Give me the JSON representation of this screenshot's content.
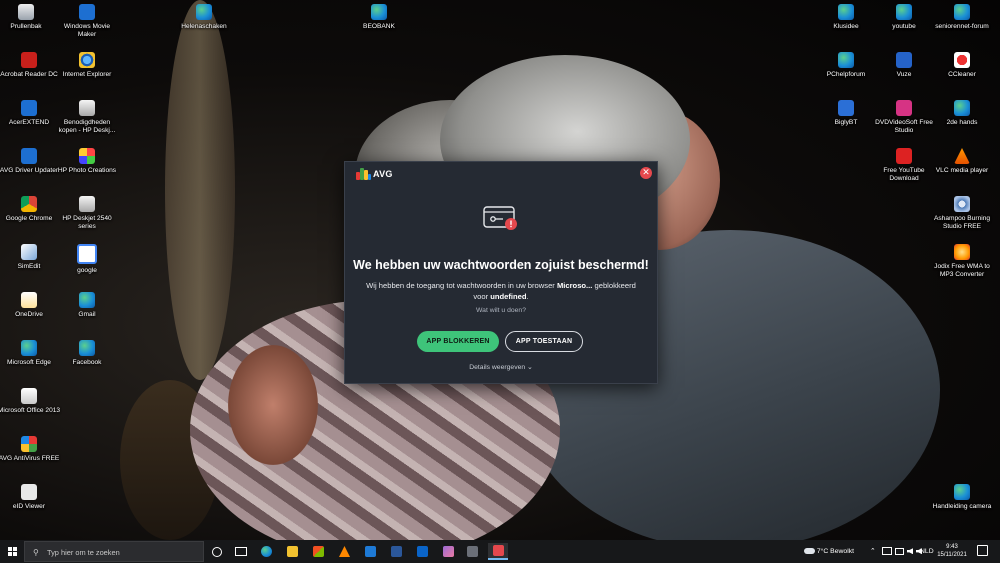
{
  "desktop": {
    "icons_left": [
      {
        "label": "Prullenbak",
        "icon": "recycle-bin-icon"
      },
      {
        "label": "Windows Movie Maker",
        "icon": "movie-maker-icon"
      },
      {
        "label": "Acrobat Reader DC",
        "icon": "acrobat-icon"
      },
      {
        "label": "Internet Explorer",
        "icon": "internet-explorer-icon"
      },
      {
        "label": "AcerEXTEND",
        "icon": "acer-extend-icon"
      },
      {
        "label": "Benodigdheden kopen - HP Deskj...",
        "icon": "hp-supplies-icon"
      },
      {
        "label": "AVG Driver Updater",
        "icon": "avg-driver-icon"
      },
      {
        "label": "HP Photo Creations",
        "icon": "hp-photo-icon"
      },
      {
        "label": "Google Chrome",
        "icon": "chrome-icon"
      },
      {
        "label": "HP Deskjet 2540 series",
        "icon": "printer-icon"
      },
      {
        "label": "SimEdit",
        "icon": "simedit-icon"
      },
      {
        "label": "google",
        "icon": "google-icon"
      },
      {
        "label": "OneDrive",
        "icon": "onedrive-icon"
      },
      {
        "label": "Gmail",
        "icon": "gmail-edge-icon"
      },
      {
        "label": "Microsoft Edge",
        "icon": "edge-icon"
      },
      {
        "label": "Facebook",
        "icon": "facebook-edge-icon"
      },
      {
        "label": "Microsoft Office 2013",
        "icon": "office-icon"
      },
      {
        "label": "AVG AntiVirus FREE",
        "icon": "avg-antivirus-icon"
      },
      {
        "label": "eID Viewer",
        "icon": "eid-viewer-icon"
      }
    ],
    "icons_top": [
      {
        "label": "Helenaschaken",
        "icon": "edge-shortcut-icon"
      },
      {
        "label": "BEOBANK",
        "icon": "edge-shortcut-icon"
      }
    ],
    "icons_right": [
      {
        "label": "Klusidee",
        "icon": "edge-shortcut-icon"
      },
      {
        "label": "youtube",
        "icon": "edge-shortcut-icon"
      },
      {
        "label": "seniorennet-forum",
        "icon": "edge-shortcut-icon"
      },
      {
        "label": "PChelpforum",
        "icon": "edge-shortcut-icon"
      },
      {
        "label": "Vuze",
        "icon": "vuze-icon"
      },
      {
        "label": "CCleaner",
        "icon": "ccleaner-icon"
      },
      {
        "label": "BiglyBT",
        "icon": "biglybt-icon"
      },
      {
        "label": "DVDVideoSoft Free Studio",
        "icon": "dvdvideosoft-icon"
      },
      {
        "label": "2de hands",
        "icon": "edge-shortcut-icon"
      },
      {
        "label": "Free YouTube Download",
        "icon": "youtube-download-icon"
      },
      {
        "label": "VLC media player",
        "icon": "vlc-icon"
      },
      {
        "label": "Ashampoo Burning Studio FREE",
        "icon": "ashampoo-icon"
      },
      {
        "label": "Jodix Free WMA to MP3 Converter",
        "icon": "jodix-icon"
      },
      {
        "label": "Handleiding camera",
        "icon": "edge-shortcut-icon"
      }
    ]
  },
  "dialog": {
    "brand": "AVG",
    "close_glyph": "✕",
    "title": "We hebben uw wachtwoorden zojuist beschermd!",
    "desc_part1": "Wij hebben de toegang tot wachtwoorden in uw browser ",
    "desc_app": "Microso...",
    "desc_part2": " geblokkeerd voor ",
    "desc_target": "undefined",
    "desc_end": ".",
    "question": "Wat wilt u doen?",
    "block_label": "APP BLOKKEREN",
    "allow_label": "APP TOESTAAN",
    "details_label": "Details weergeven",
    "details_chevron": "⌄",
    "accent_green": "#3ec47a",
    "close_red": "#e5484d"
  },
  "taskbar": {
    "search_placeholder": "Typ hier om te zoeken",
    "weather": "7°C  Bewolkt",
    "language": "NLD",
    "time": "9:43",
    "date": "15/11/2021",
    "up_arrow": "⌃"
  }
}
